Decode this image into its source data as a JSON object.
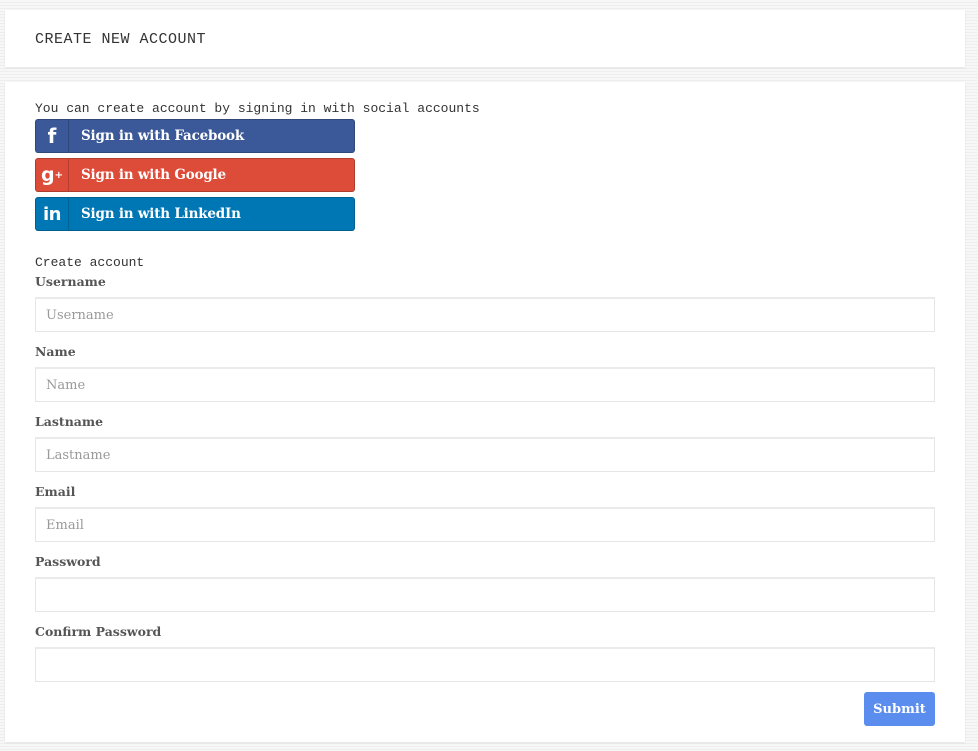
{
  "header": {
    "title": "CREATE NEW ACCOUNT"
  },
  "social": {
    "intro": "You can create account by signing in with social accounts",
    "buttons": [
      {
        "label": "Sign in with Facebook",
        "icon": "facebook-icon",
        "icon_glyph": "f",
        "color": "#3b5998"
      },
      {
        "label": "Sign in with Google",
        "icon": "google-plus-icon",
        "icon_glyph": "g",
        "icon_sup": "+",
        "color": "#dd4b39"
      },
      {
        "label": "Sign in with LinkedIn",
        "icon": "linkedin-icon",
        "icon_glyph": "in",
        "color": "#0077b5"
      }
    ]
  },
  "form": {
    "section_title": "Create account",
    "fields": [
      {
        "label": "Username",
        "placeholder": "Username",
        "value": "",
        "type": "text"
      },
      {
        "label": "Name",
        "placeholder": "Name",
        "value": "",
        "type": "text"
      },
      {
        "label": "Lastname",
        "placeholder": "Lastname",
        "value": "",
        "type": "text"
      },
      {
        "label": "Email",
        "placeholder": "Email",
        "value": "",
        "type": "email"
      },
      {
        "label": "Password",
        "placeholder": "",
        "value": "",
        "type": "password"
      },
      {
        "label": "Confirm Password",
        "placeholder": "",
        "value": "",
        "type": "password"
      }
    ],
    "submit_label": "Submit",
    "submit_color": "#5b8def"
  }
}
